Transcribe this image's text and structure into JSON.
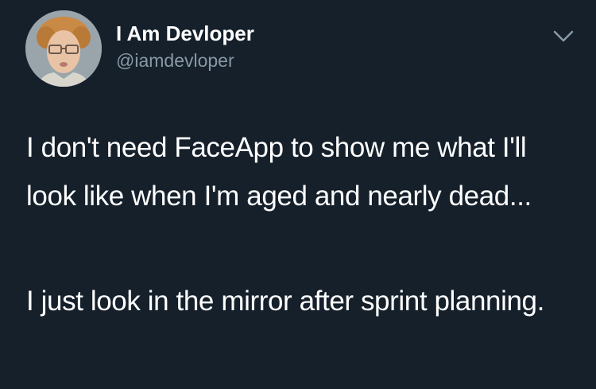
{
  "author": {
    "display_name": "I Am Devloper",
    "handle": "@iamdevloper",
    "avatar_icon": "profile-photo"
  },
  "menu": {
    "icon": "chevron-down-icon"
  },
  "tweet": {
    "paragraphs": [
      "I don't need FaceApp to show me what I'll look like when I'm aged and nearly dead...",
      "I just look in the mirror after sprint planning."
    ]
  },
  "colors": {
    "background": "#15202b",
    "primary_text": "#ffffff",
    "secondary_text": "#8899a6"
  }
}
